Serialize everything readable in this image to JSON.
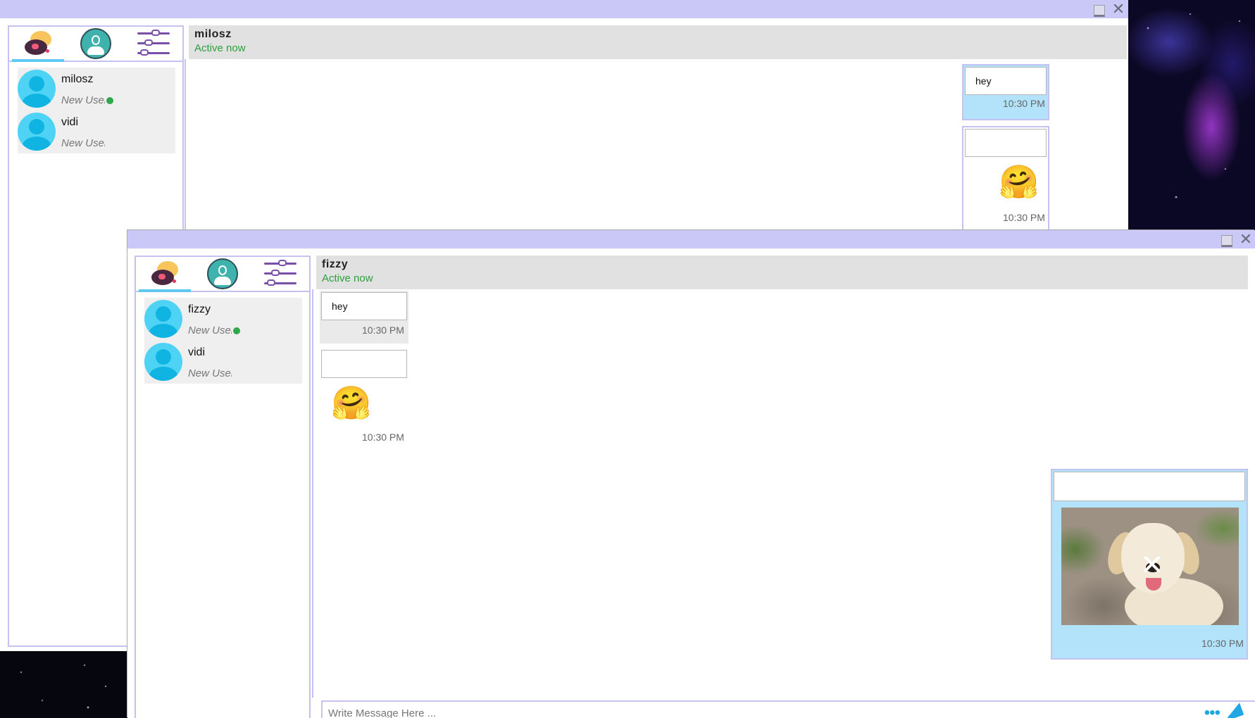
{
  "window_back": {
    "chat": {
      "name": "milosz",
      "status": "Active now"
    },
    "contacts": [
      {
        "name": "milosz",
        "status": "New User",
        "online": true
      },
      {
        "name": "vidi",
        "status": "New User",
        "online": false
      }
    ],
    "messages": {
      "m1_text": "hey",
      "m1_time": "10:30 PM",
      "m2_time": "10:30 PM"
    }
  },
  "window_front": {
    "chat": {
      "name": "fizzy",
      "status": "Active now"
    },
    "contacts": [
      {
        "name": "fizzy",
        "status": "New User",
        "online": true
      },
      {
        "name": "vidi",
        "status": "New User",
        "online": false
      }
    ],
    "messages": {
      "r1_text": "hey",
      "r1_time": "10:30 PM",
      "r2_time": "10:30 PM",
      "s1_time": "10:30 PM"
    },
    "composer": {
      "placeholder": "Write Message Here ...",
      "more": "•••"
    }
  },
  "titlebar": {
    "close_glyph": "✕"
  },
  "emoji": "🤗",
  "colors": {
    "titlebar": "#c9c8f7",
    "accent_border": "#c3c2f0",
    "sent_bubble": "#b3e3fb",
    "online": "#2ea84a",
    "active_text": "#2e9e3e"
  },
  "icons": [
    "chat-icon",
    "profile-icon",
    "settings-icon",
    "minimize-icon",
    "close-icon",
    "avatar-icon",
    "send-icon",
    "more-icon"
  ]
}
